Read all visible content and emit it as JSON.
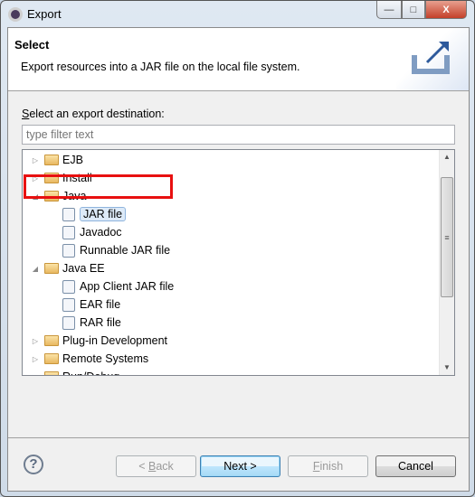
{
  "window": {
    "title": "Export",
    "minimize": "—",
    "maximize": "□",
    "close": "X"
  },
  "header": {
    "title": "Select",
    "description": "Export resources into a JAR file on the local file system.",
    "icon": "export-icon"
  },
  "destination_label_mnemonic": "S",
  "destination_label_rest": "elect an export destination:",
  "filter": {
    "value": "",
    "placeholder": "type filter text"
  },
  "tree": [
    {
      "label": "EJB",
      "level": 0,
      "type": "folder",
      "expanded": false
    },
    {
      "label": "Install",
      "level": 0,
      "type": "folder",
      "expanded": false
    },
    {
      "label": "Java",
      "level": 0,
      "type": "folder",
      "expanded": true
    },
    {
      "label": "JAR file",
      "level": 1,
      "type": "item",
      "selected": true
    },
    {
      "label": "Javadoc",
      "level": 1,
      "type": "item"
    },
    {
      "label": "Runnable JAR file",
      "level": 1,
      "type": "item"
    },
    {
      "label": "Java EE",
      "level": 0,
      "type": "folder",
      "expanded": true
    },
    {
      "label": "App Client JAR file",
      "level": 1,
      "type": "item"
    },
    {
      "label": "EAR file",
      "level": 1,
      "type": "item"
    },
    {
      "label": "RAR file",
      "level": 1,
      "type": "item"
    },
    {
      "label": "Plug-in Development",
      "level": 0,
      "type": "folder",
      "expanded": false
    },
    {
      "label": "Remote Systems",
      "level": 0,
      "type": "folder",
      "expanded": false
    },
    {
      "label": "Run/Debug",
      "level": 0,
      "type": "folder",
      "expanded": false
    }
  ],
  "buttons": {
    "back_pre": "< ",
    "back_mn": "B",
    "back_rest": "ack",
    "next": "Next >",
    "finish_mn": "F",
    "finish_rest": "inish",
    "cancel": "Cancel",
    "help": "?"
  },
  "colors": {
    "highlight": "#e81010",
    "selection": "#ddeaf8"
  }
}
